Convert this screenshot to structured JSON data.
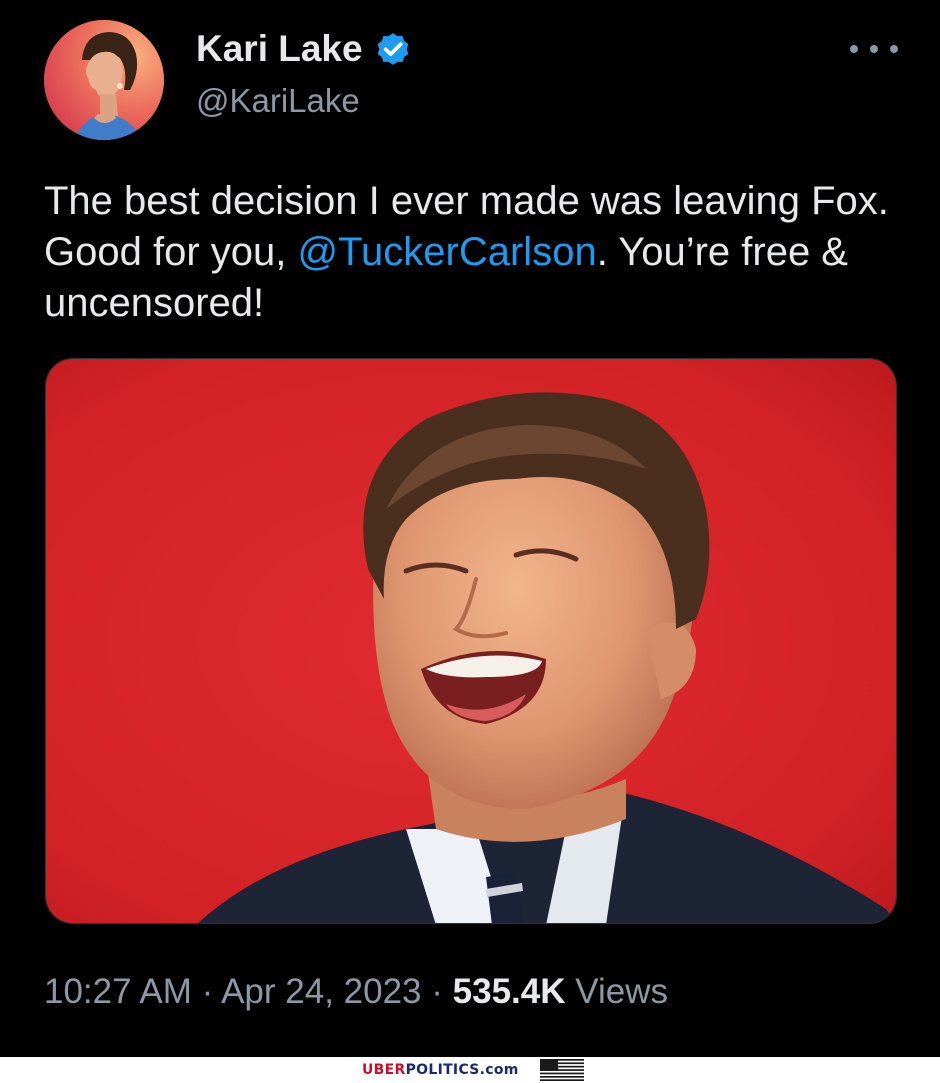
{
  "tweet": {
    "author": {
      "display_name": "Kari Lake",
      "handle": "@KariLake",
      "verified": true
    },
    "text_before": "The best decision I ever made was leaving Fox. Good for you, ",
    "mention": "@TuckerCarlson",
    "text_after": ". You’re free & uncensored!",
    "timestamp": {
      "time": "10:27 AM",
      "separator": "·",
      "date": "Apr 24, 2023",
      "views_count": "535.4K",
      "views_label": "Views"
    }
  },
  "watermark": {
    "part1": "UBER",
    "part2": "POLITICS",
    "part3": ".com"
  },
  "colors": {
    "background": "#000000",
    "text_primary": "#e7e9ea",
    "text_secondary": "#8b98a5",
    "accent": "#1d9bf0",
    "media_red": "#d6232a"
  },
  "icons": {
    "verified": "verified-badge-icon",
    "more": "more-options-icon",
    "flag": "us-flag-icon"
  }
}
